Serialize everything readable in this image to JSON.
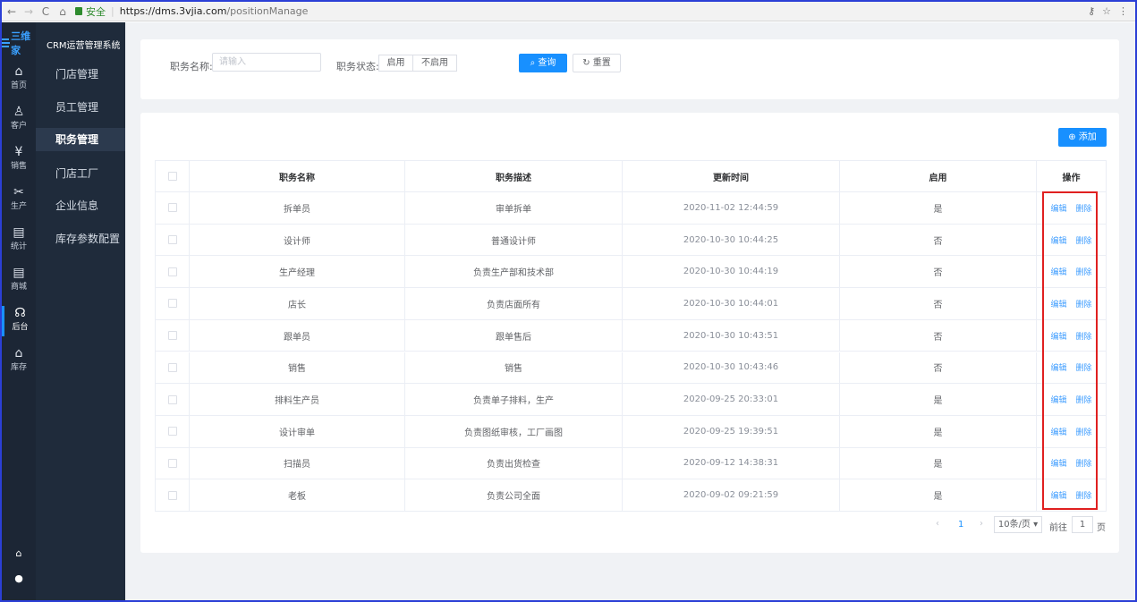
{
  "browser": {
    "secure_label": "安全",
    "url_host": "https://dms.3vjia.com",
    "url_path": "/positionManage"
  },
  "app": {
    "logo_text": "三维家",
    "title": "CRM运营管理系统"
  },
  "rail": [
    {
      "icon": "home-icon",
      "glyph": "⌂",
      "label": "首页"
    },
    {
      "icon": "customer-icon",
      "glyph": "♙",
      "label": "客户"
    },
    {
      "icon": "yuan-icon",
      "glyph": "¥",
      "label": "销售"
    },
    {
      "icon": "tools-icon",
      "glyph": "✂",
      "label": "生产"
    },
    {
      "icon": "document-icon",
      "glyph": "▤",
      "label": "统计"
    },
    {
      "icon": "mall-icon",
      "glyph": "▤",
      "label": "商城"
    },
    {
      "icon": "backend-icon",
      "glyph": "☊",
      "label": "后台"
    },
    {
      "icon": "warehouse-icon",
      "glyph": "⌂",
      "label": "库存"
    }
  ],
  "submenu": [
    "门店管理",
    "员工管理",
    "职务管理",
    "门店工厂",
    "企业信息",
    "库存参数配置"
  ],
  "filter": {
    "name_label": "职务名称:",
    "name_placeholder": "请输入",
    "status_label": "职务状态:",
    "status_options": [
      "启用",
      "不启用"
    ],
    "search_label": "查询",
    "reset_label": "重置"
  },
  "add_label": "添加",
  "table": {
    "headers": [
      "职务名称",
      "职务描述",
      "更新时间",
      "启用",
      "操作"
    ],
    "rows": [
      {
        "name": "拆单员",
        "desc": "审单拆单",
        "time": "2020-11-02 12:44:59",
        "enabled": "是"
      },
      {
        "name": "设计师",
        "desc": "普通设计师",
        "time": "2020-10-30 10:44:25",
        "enabled": "否"
      },
      {
        "name": "生产经理",
        "desc": "负责生产部和技术部",
        "time": "2020-10-30 10:44:19",
        "enabled": "否"
      },
      {
        "name": "店长",
        "desc": "负责店面所有",
        "time": "2020-10-30 10:44:01",
        "enabled": "否"
      },
      {
        "name": "跟单员",
        "desc": "跟单售后",
        "time": "2020-10-30 10:43:51",
        "enabled": "否"
      },
      {
        "name": "销售",
        "desc": "销售",
        "time": "2020-10-30 10:43:46",
        "enabled": "否"
      },
      {
        "name": "排料生产员",
        "desc": "负责单子排料，生产",
        "time": "2020-09-25 20:33:01",
        "enabled": "是"
      },
      {
        "name": "设计审单",
        "desc": "负责图纸审核，工厂画图",
        "time": "2020-09-25 19:39:51",
        "enabled": "是"
      },
      {
        "name": "扫描员",
        "desc": "负责出货检查",
        "time": "2020-09-12 14:38:31",
        "enabled": "是"
      },
      {
        "name": "老板",
        "desc": "负责公司全面",
        "time": "2020-09-02 09:21:59",
        "enabled": "是"
      }
    ],
    "edit_label": "编辑",
    "delete_label": "删除"
  },
  "pagination": {
    "current_page": "1",
    "page_size": "10条/页",
    "goto_label": "前往",
    "goto_value": "1",
    "page_suffix": "页"
  }
}
